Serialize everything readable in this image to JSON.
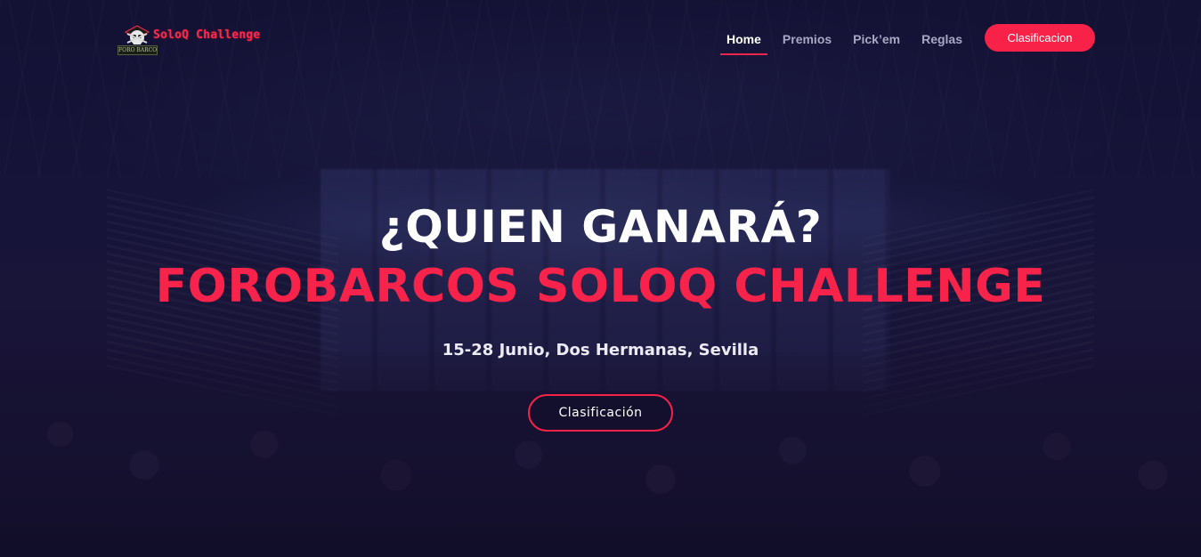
{
  "brand": {
    "logo_text": "SoloQ Challenge",
    "logo_subtext": "FORO BARCOS",
    "accent_color": "#f82249"
  },
  "nav": {
    "items": [
      {
        "label": "Home",
        "active": true
      },
      {
        "label": "Premios",
        "active": false
      },
      {
        "label": "Pick’em",
        "active": false
      },
      {
        "label": "Reglas",
        "active": false
      }
    ],
    "cta_label": "Clasificacion"
  },
  "hero": {
    "title": "¿QUIEN GANARÁ?",
    "subtitle": "FOROBARCOS SOLOQ CHALLENGE",
    "date_location": "15-28 Junio, Dos Hermanas, Sevilla",
    "button_label": "Clasificación"
  }
}
